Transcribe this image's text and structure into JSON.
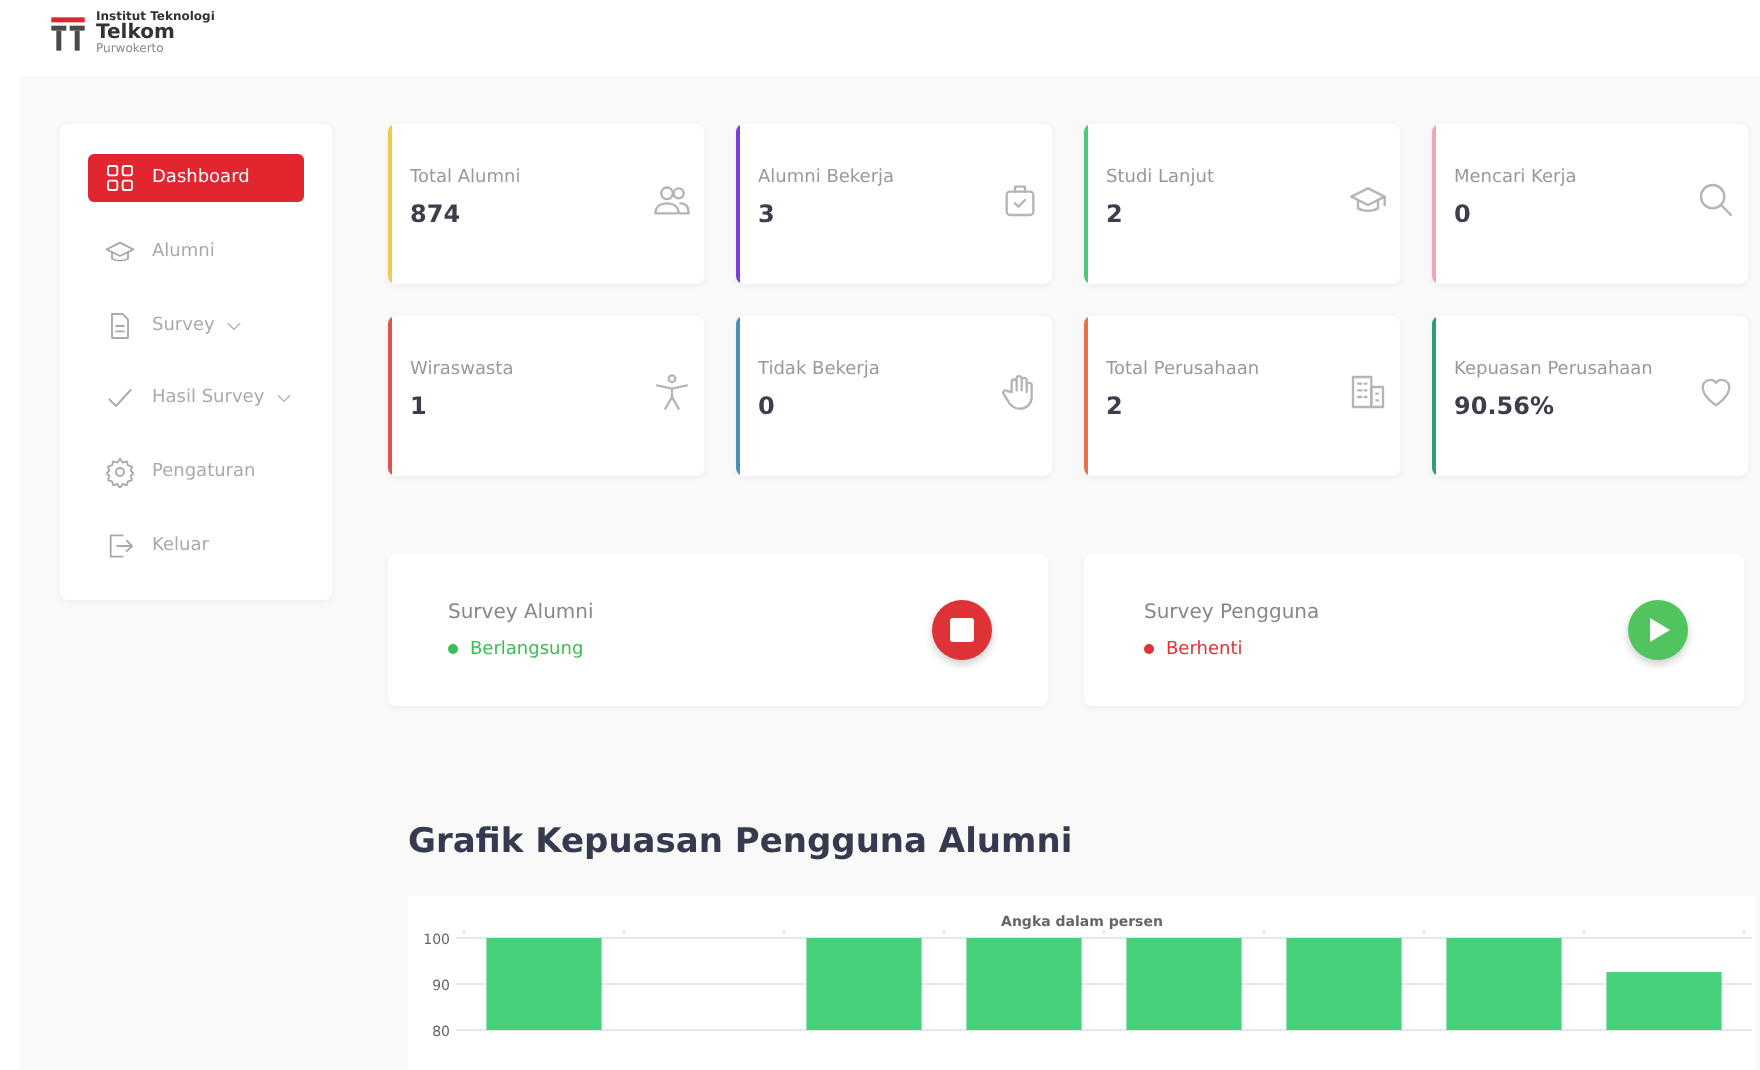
{
  "logo": {
    "line_1": "Institut Teknologi",
    "line_2": "Telkom",
    "line_3": "Purwokerto"
  },
  "sidebar": {
    "items": [
      {
        "label": "Dashboard",
        "selected": true,
        "expandable": false
      },
      {
        "label": "Alumni",
        "selected": false,
        "expandable": false
      },
      {
        "label": "Survey",
        "selected": false,
        "expandable": true
      },
      {
        "label": "Hasil Survey",
        "selected": false,
        "expandable": true
      },
      {
        "label": "Pengaturan",
        "selected": false,
        "expandable": false
      },
      {
        "label": "Keluar",
        "selected": false,
        "expandable": false
      }
    ]
  },
  "stats": [
    {
      "label": "Total Alumni",
      "value": "874",
      "color": "#f2c94c"
    },
    {
      "label": "Alumni Bekerja",
      "value": "3",
      "color": "#7b3fd6"
    },
    {
      "label": "Studi Lanjut",
      "value": "2",
      "color": "#4cc97a"
    },
    {
      "label": "Mencari Kerja",
      "value": "0",
      "color": "#f4a6b6"
    },
    {
      "label": "Wiraswasta",
      "value": "1",
      "color": "#e05252"
    },
    {
      "label": "Tidak Bekerja",
      "value": "0",
      "color": "#4a8fb8"
    },
    {
      "label": "Total Perusahaan",
      "value": "2",
      "color": "#e8704e"
    },
    {
      "label": "Kepuasan Perusahaan",
      "value": "90.56%",
      "color": "#2f9e72"
    }
  ],
  "surveys": [
    {
      "title": "Survey Alumni",
      "status": "Berlangsung",
      "running": true
    },
    {
      "title": "Survey Pengguna",
      "status": "Berhenti",
      "running": false
    }
  ],
  "chart": {
    "heading": "Grafik Kepuasan Pengguna Alumni",
    "chart_data": {
      "type": "bar",
      "title": "Angka dalam persen",
      "series": [
        {
          "color": "#47d17a",
          "values": [
            100,
            null,
            100,
            100,
            100,
            100,
            100,
            92.6
          ]
        }
      ],
      "ylim": [
        80,
        100
      ],
      "yticks": [
        80,
        90,
        100
      ]
    }
  }
}
